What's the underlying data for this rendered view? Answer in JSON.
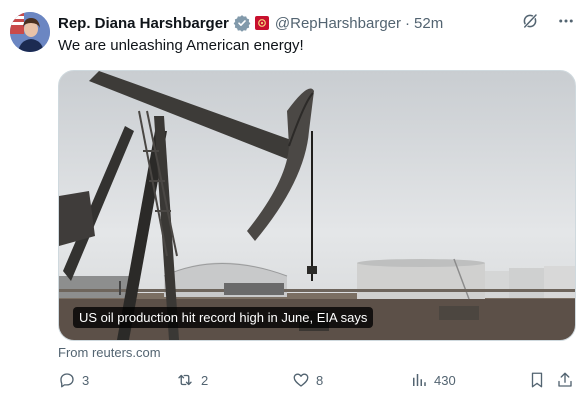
{
  "author": {
    "name": "Rep. Diana Harshbarger",
    "handle": "@RepHarshbarger",
    "separator": "·",
    "time": "52m",
    "verified_badge_icon": "gray-verified-badge-icon",
    "affiliate_icon": "house-seal-flag-icon"
  },
  "tweet": {
    "text": "We are unleashing American energy!"
  },
  "card": {
    "caption": "US oil production hit record high in June, EIA says",
    "source": "From reuters.com"
  },
  "actions": {
    "replies": "3",
    "reposts": "2",
    "likes": "8",
    "views": "430"
  },
  "colors": {
    "secondary_text": "#536471",
    "border": "#cfd9de",
    "flag_red": "#c8102e"
  }
}
